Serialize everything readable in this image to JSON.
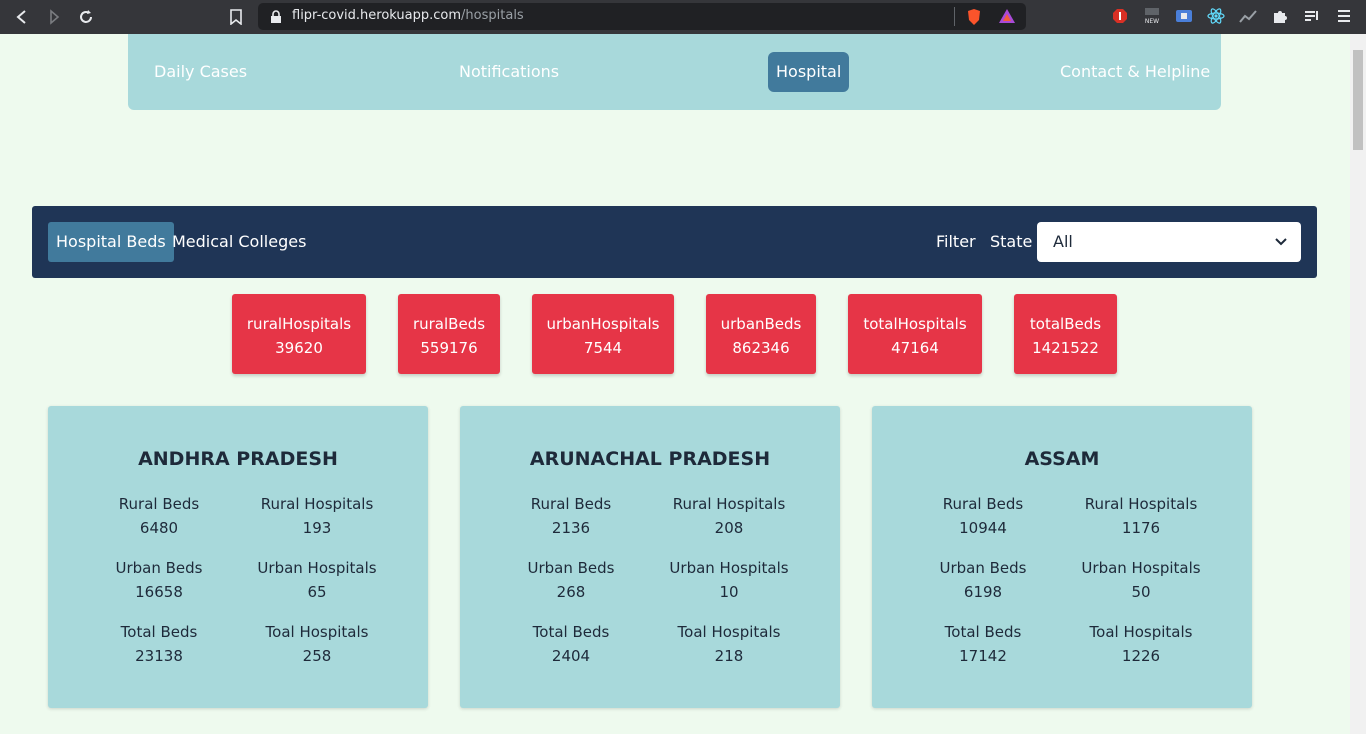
{
  "browser": {
    "url_host": "flipr-covid.herokuapp.com",
    "url_path": "/hospitals"
  },
  "nav": {
    "items": [
      {
        "label": "Daily Cases",
        "active": false
      },
      {
        "label": "Notifications",
        "active": false
      },
      {
        "label": "Hospital",
        "active": true
      },
      {
        "label": "Contact & Helpline",
        "active": false
      }
    ]
  },
  "filterbar": {
    "tabs": [
      {
        "label": "Hospital Beds",
        "active": true
      },
      {
        "label": "Medical Colleges",
        "active": false
      }
    ],
    "filter_label": "Filter",
    "state_label": "State",
    "state_value": "All"
  },
  "stats": [
    {
      "label": "ruralHospitals",
      "value": "39620"
    },
    {
      "label": "ruralBeds",
      "value": "559176"
    },
    {
      "label": "urbanHospitals",
      "value": "7544"
    },
    {
      "label": "urbanBeds",
      "value": "862346"
    },
    {
      "label": "totalHospitals",
      "value": "47164"
    },
    {
      "label": "totalBeds",
      "value": "1421522"
    }
  ],
  "cards": [
    {
      "state": "ANDHRA PRADESH",
      "rural_beds_label": "Rural Beds",
      "rural_beds": "6480",
      "rural_hospitals_label": "Rural Hospitals",
      "rural_hospitals": "193",
      "urban_beds_label": "Urban Beds",
      "urban_beds": "16658",
      "urban_hospitals_label": "Urban Hospitals",
      "urban_hospitals": "65",
      "total_beds_label": "Total Beds",
      "total_beds": "23138",
      "total_hospitals_label": "Toal Hospitals",
      "total_hospitals": "258"
    },
    {
      "state": "ARUNACHAL PRADESH",
      "rural_beds_label": "Rural Beds",
      "rural_beds": "2136",
      "rural_hospitals_label": "Rural Hospitals",
      "rural_hospitals": "208",
      "urban_beds_label": "Urban Beds",
      "urban_beds": "268",
      "urban_hospitals_label": "Urban Hospitals",
      "urban_hospitals": "10",
      "total_beds_label": "Total Beds",
      "total_beds": "2404",
      "total_hospitals_label": "Toal Hospitals",
      "total_hospitals": "218"
    },
    {
      "state": "ASSAM",
      "rural_beds_label": "Rural Beds",
      "rural_beds": "10944",
      "rural_hospitals_label": "Rural Hospitals",
      "rural_hospitals": "1176",
      "urban_beds_label": "Urban Beds",
      "urban_beds": "6198",
      "urban_hospitals_label": "Urban Hospitals",
      "urban_hospitals": "50",
      "total_beds_label": "Total Beds",
      "total_beds": "17142",
      "total_hospitals_label": "Toal Hospitals",
      "total_hospitals": "1226"
    }
  ],
  "colors": {
    "nav_bg": "#a8d9db",
    "active": "#417a9c",
    "filterbar_bg": "#1f3556",
    "stat_bg": "#e63547",
    "page_bg": "#eefaee"
  }
}
